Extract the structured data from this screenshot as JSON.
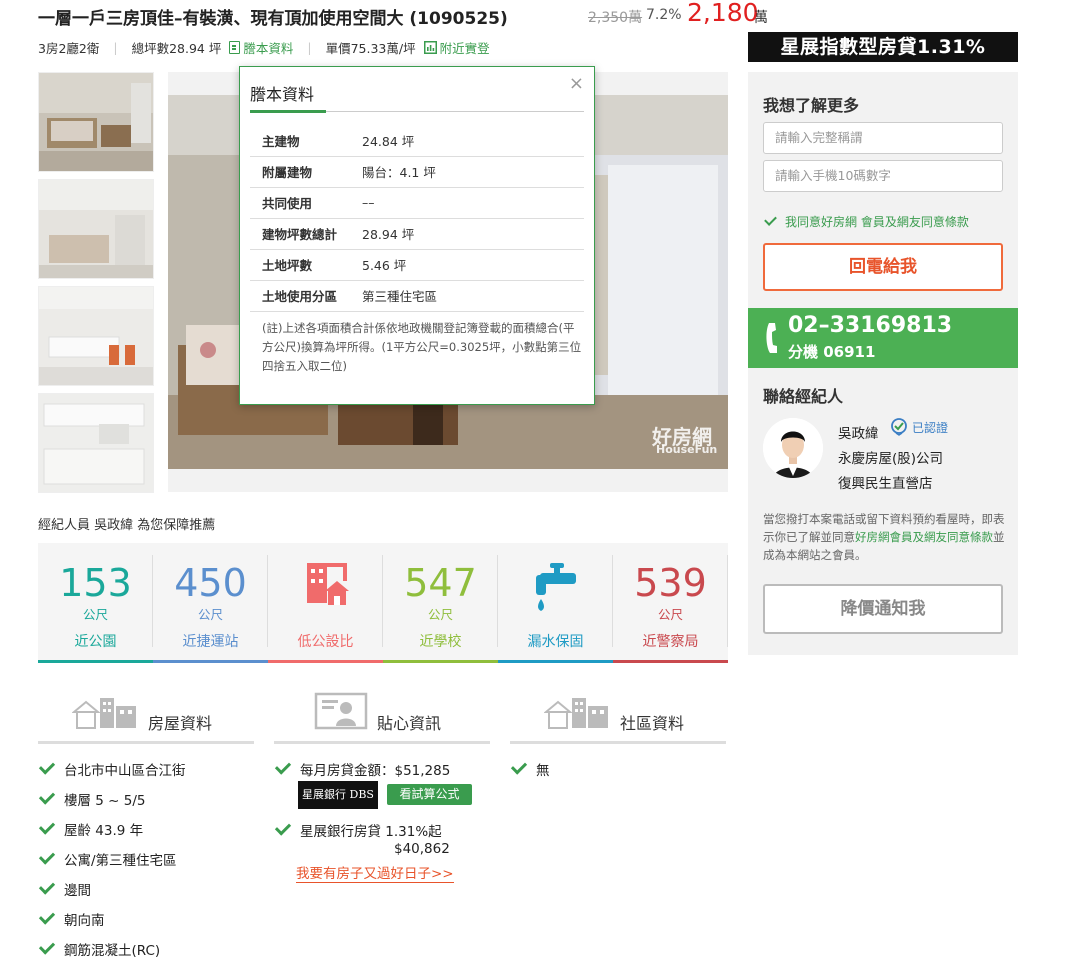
{
  "listing": {
    "title": "一層一戶三房頂佳–有裝潢、現有頂加使用空間大 (1090525)",
    "old_price": "2,350萬",
    "discount": "7.2%",
    "price": "2,180",
    "price_unit": "萬",
    "layout": "3房2廳2衛",
    "total_area": "總坪數28.94 坪",
    "deed_link": "謄本資料",
    "unit_price": "單價75.33萬/坪",
    "nearby_link": "附近實登",
    "watermark": "好房網",
    "watermark_sub": "HouseFun"
  },
  "popup": {
    "title": "謄本資料",
    "close": "×",
    "rows": [
      {
        "k": "主建物",
        "v": "24.84 坪"
      },
      {
        "k": "附屬建物",
        "v": "陽台：4.1 坪"
      },
      {
        "k": "共同使用",
        "v": "––"
      },
      {
        "k": "建物坪數總計",
        "v": "28.94 坪"
      },
      {
        "k": "土地坪數",
        "v": "5.46 坪"
      },
      {
        "k": "土地使用分區",
        "v": "第三種住宅區"
      }
    ],
    "note": "(註)上述各項面積合計係依地政機關登記簿登載的面積總合(平方公尺)換算為坪所得。(1平方公尺=0.3025坪，小數點第三位四捨五入取二位)"
  },
  "recommend": "經紀人員 吳政緯 為您保障推薦",
  "stats": [
    {
      "num": "153",
      "unit": "公尺",
      "label": "近公園",
      "color": "#1aa89a"
    },
    {
      "num": "450",
      "unit": "公尺",
      "label": "近捷運站",
      "color": "#5b8fce"
    },
    {
      "num": "",
      "unit": "",
      "label": "低公設比",
      "color": "#f06b6b",
      "icon": "building-icon"
    },
    {
      "num": "547",
      "unit": "公尺",
      "label": "近學校",
      "color": "#8fbe3c"
    },
    {
      "num": "",
      "unit": "",
      "label": "漏水保固",
      "color": "#1f9bc4",
      "icon": "faucet-icon"
    },
    {
      "num": "539",
      "unit": "公尺",
      "label": "近警察局",
      "color": "#c9494e"
    }
  ],
  "sections": {
    "house": {
      "title": "房屋資料",
      "items": [
        "台北市中山區合江街",
        "樓層 5 ~ 5/5",
        "屋齡 43.9 年",
        "公寓/第三種住宅區",
        "邊間",
        "朝向南",
        "鋼筋混凝土(RC)"
      ]
    },
    "tips": {
      "title": "貼心資訊",
      "mortgage": "每月房貸金額：$51,285",
      "bank_logo": "星展銀行 DBS",
      "calc_btn": "看試算公式",
      "loan": "星展銀行房貸 1.31%起",
      "loan_amount": "$40,862",
      "promo": "我要有房子又過好日子>>"
    },
    "community": {
      "title": "社區資料",
      "items": [
        "無"
      ]
    }
  },
  "sidebar": {
    "banner": "星展指數型房貸1.31%",
    "heading": "我想了解更多",
    "name_placeholder": "請輸入完整稱謂",
    "phone_placeholder": "請輸入手機10碼數字",
    "agree": "我同意好房網 會員及網友同意條款",
    "call_btn": "回電給我",
    "phone": "02–33169813",
    "ext": "分機 06911",
    "contact_heading": "聯絡經紀人",
    "agent_name": "吳政緯",
    "verified": "已認證",
    "company": "永慶房屋(股)公司",
    "branch": "復興民生直營店",
    "disclaimer_a": "當您撥打本案電話或留下資料預約看屋時，即表示你已了解並同意",
    "disclaimer_link": "好房網會員及網友同意條款",
    "disclaimer_b": "並成為本網站之會員。",
    "notify_btn": "降價通知我"
  },
  "colors": {
    "accent": "#3a9c4e",
    "price": "#e02020",
    "call": "#e8542b",
    "phonebar": "#4cb054"
  }
}
